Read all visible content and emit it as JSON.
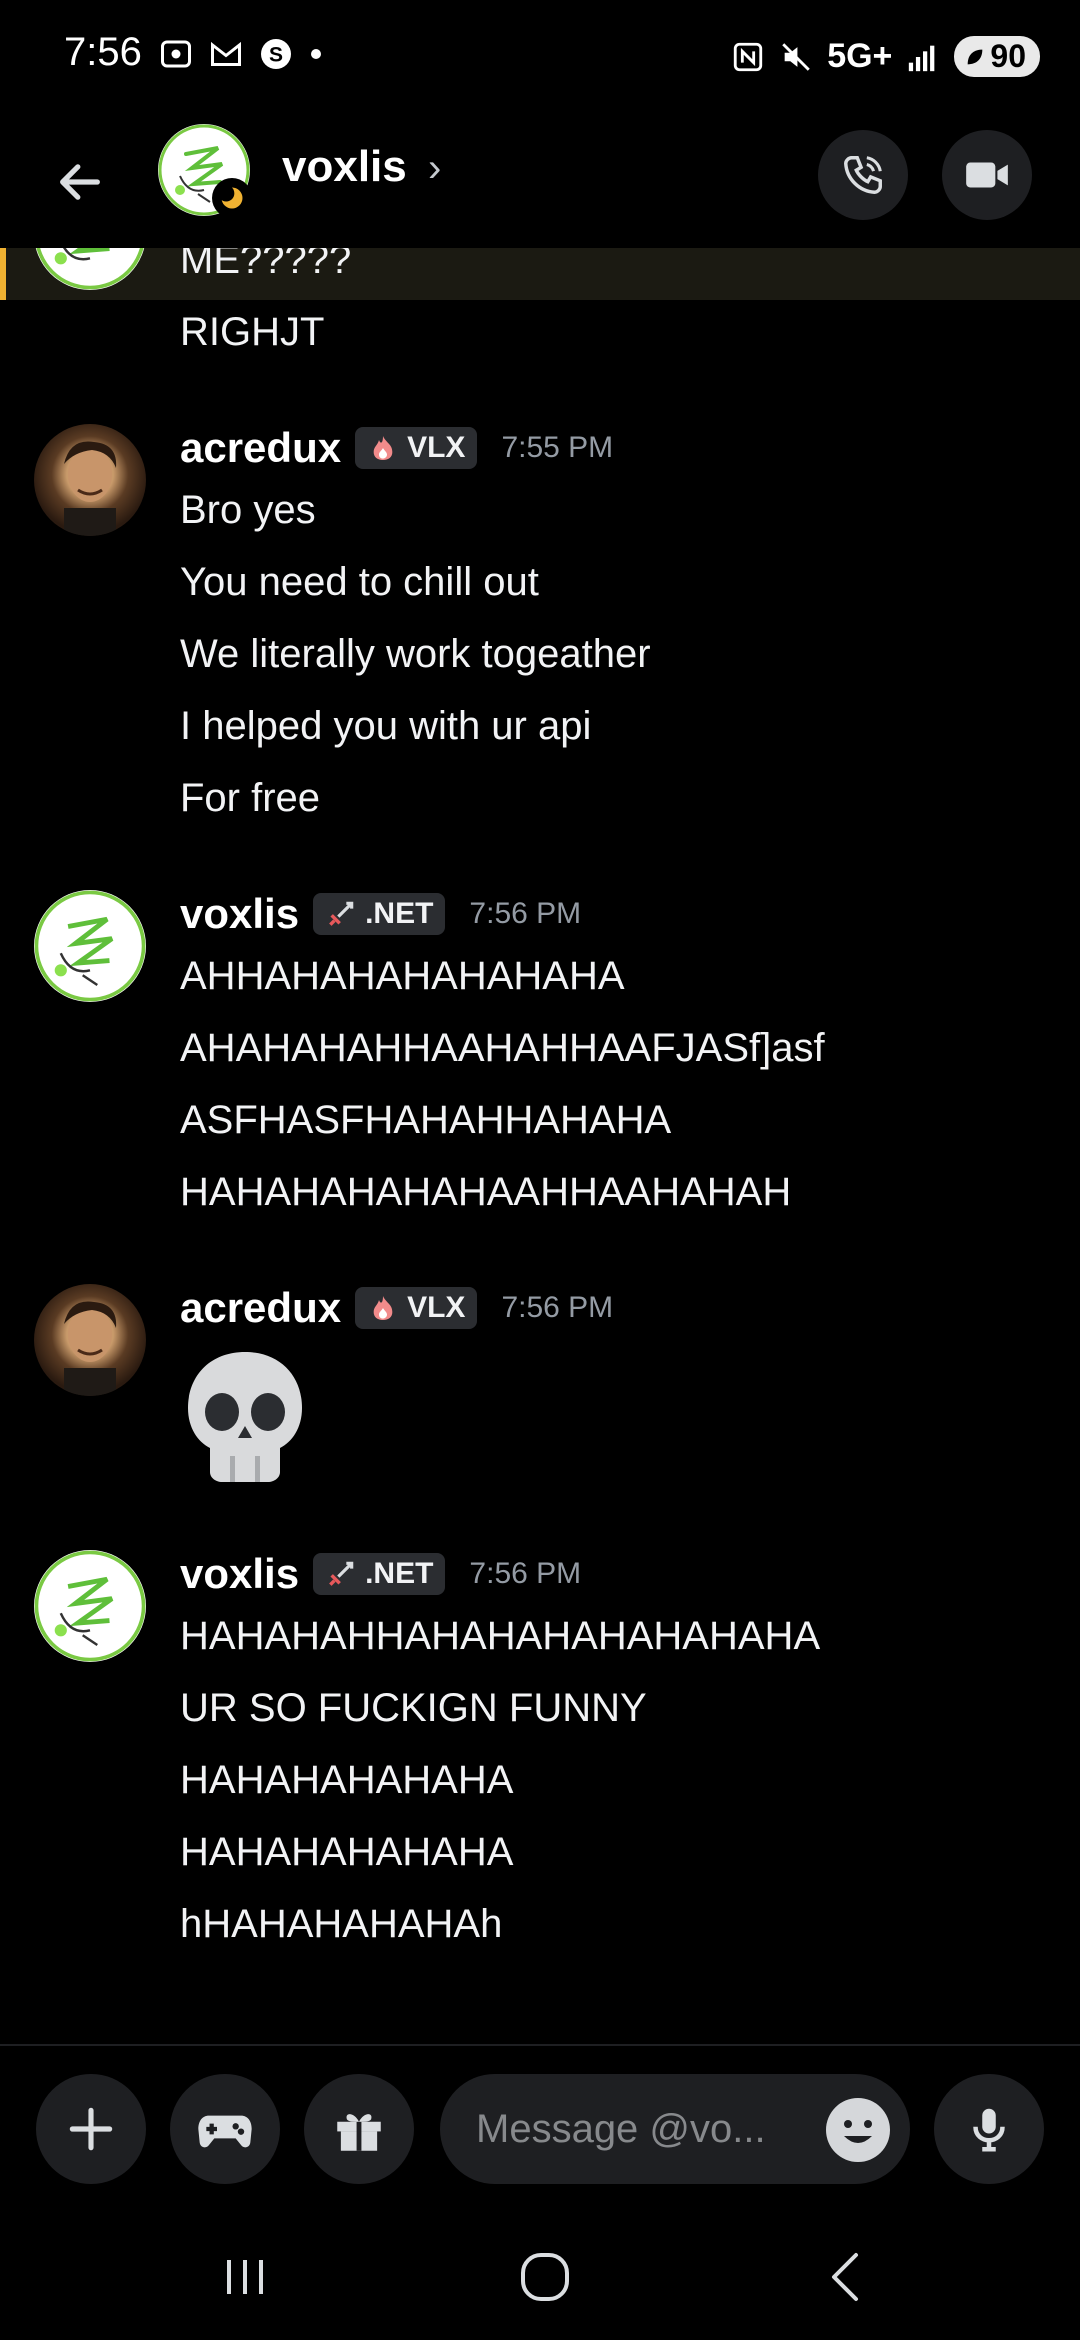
{
  "status_bar": {
    "time": "7:56",
    "network": "5G+",
    "battery": "90"
  },
  "header": {
    "title": "voxlis"
  },
  "messages": {
    "top_partial": [
      "ME?????",
      "RIGHJT"
    ],
    "groups": [
      {
        "author": "acredux",
        "tag": "VLX",
        "time": "7:55 PM",
        "lines": [
          "Bro yes",
          "You need to chill out",
          "We literally work togeather",
          "I helped you with ur api",
          "For free"
        ]
      },
      {
        "author": "voxlis",
        "tag": ".NET",
        "time": "7:56 PM",
        "lines": [
          "AHHAHAHAHAHAHAHA",
          "AHAHAHAHHAAHAHHAAFJASf]asf",
          "ASFHASFHAHAHHAHAHA",
          "HAHAHAHAHAHAAHHAAHAHAH"
        ]
      },
      {
        "author": "acredux",
        "tag": "VLX",
        "time": "7:56 PM",
        "emoji": "skull"
      },
      {
        "author": "voxlis",
        "tag": ".NET",
        "time": "7:56 PM",
        "lines": [
          "HAHAHAHHAHAHAHAHAHAHAHA",
          "UR SO FUCKIGN FUNNY",
          "HAHAHAHAHAHA",
          "HAHAHAHAHAHA",
          "hHAHAHAHAHAh"
        ]
      }
    ]
  },
  "composer": {
    "placeholder": "Message @vo..."
  },
  "colors": {
    "background": "#000000",
    "surface": "#1e1f22",
    "highlight_accent": "#f0b232",
    "timestamp": "#949ba4"
  }
}
